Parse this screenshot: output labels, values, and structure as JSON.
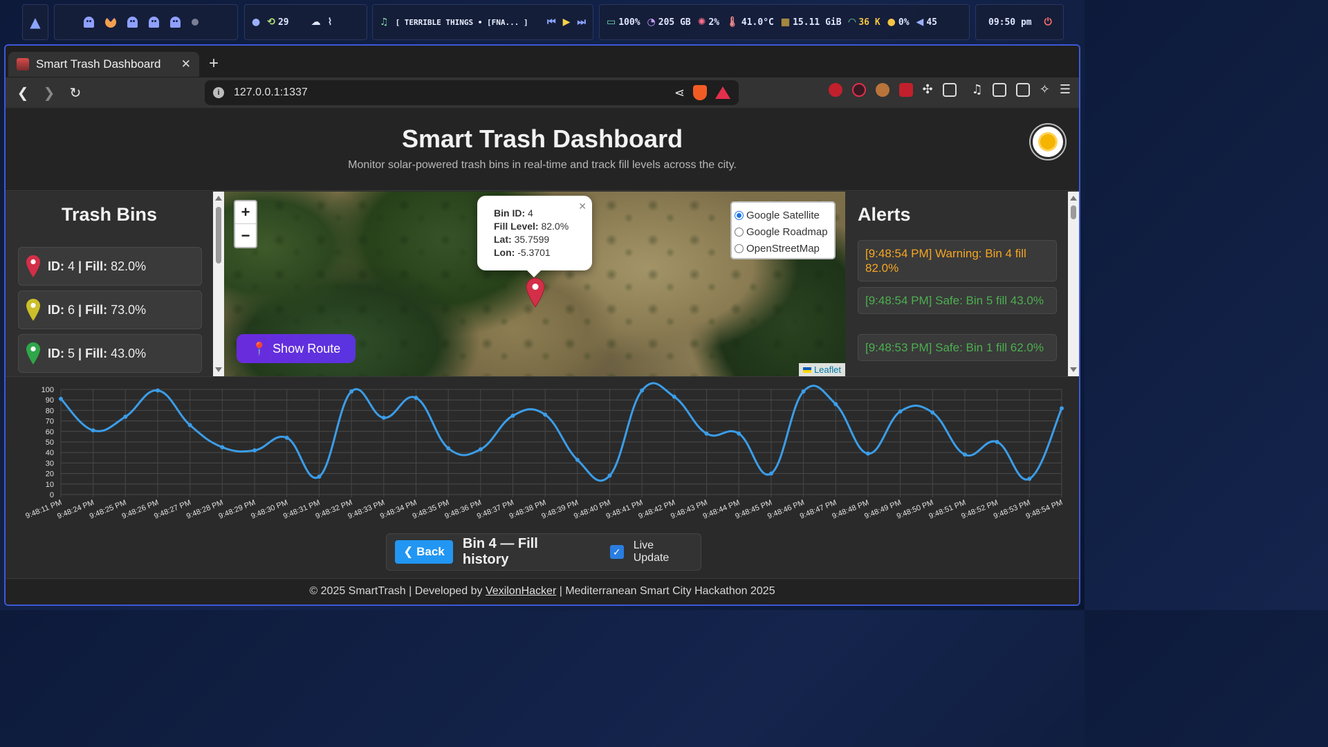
{
  "system_bar": {
    "git_count": "29",
    "music": "[ TERRIBLE THINGS • [FNA... ]",
    "battery": "100%",
    "disk": "205 GB",
    "cpu": "2%",
    "temp": "41.0°C",
    "ram": "15.11 GiB",
    "wifi": "36 K",
    "bright": "0%",
    "volume": "45",
    "clock": "09:50 pm"
  },
  "browser": {
    "tab_title": "Smart Trash Dashboard",
    "url": "127.0.0.1:1337"
  },
  "header": {
    "title": "Smart Trash Dashboard",
    "subtitle": "Monitor solar-powered trash bins in real-time and track fill levels across the city."
  },
  "bins": {
    "title": "Trash Bins",
    "id_label": "ID:",
    "fill_label": "| Fill:",
    "items": [
      {
        "id": "4",
        "fill": "82.0%",
        "color": "#d32f48"
      },
      {
        "id": "6",
        "fill": "73.0%",
        "color": "#cbbf2a"
      },
      {
        "id": "5",
        "fill": "43.0%",
        "color": "#2fa64a"
      }
    ]
  },
  "map": {
    "popup": {
      "bin_label": "Bin ID:",
      "bin_value": "4",
      "fill_label": "Fill Level:",
      "fill_value": "82.0%",
      "lat_label": "Lat:",
      "lat_value": "35.7599",
      "lon_label": "Lon:",
      "lon_value": "-5.3701"
    },
    "layers": [
      "Google Satellite",
      "Google Roadmap",
      "OpenStreetMap"
    ],
    "selected_layer": "Google Satellite",
    "route_button": "Show Route",
    "attribution": "Leaflet",
    "zoom_in": "+",
    "zoom_out": "−"
  },
  "alerts": {
    "title": "Alerts",
    "items": [
      {
        "text": "[9:48:54 PM] Warning: Bin 4 fill 82.0%",
        "level": "warn"
      },
      {
        "text": "[9:48:54 PM] Safe: Bin 5 fill 43.0%",
        "level": "safe"
      },
      {
        "text": "[9:48:53 PM] Safe: Bin 1 fill 62.0%",
        "level": "safe"
      }
    ]
  },
  "history": {
    "back_label": "❮ Back",
    "title": "Bin 4 — Fill history",
    "live_label": "Live Update",
    "live_checked": true
  },
  "chart_data": {
    "type": "line",
    "ylim": [
      0,
      100
    ],
    "yticks": [
      0,
      10,
      20,
      30,
      40,
      50,
      60,
      70,
      80,
      90,
      100
    ],
    "grid": true,
    "line_color": "#3b9de8",
    "categories": [
      "9:48:11 PM",
      "9:48:24 PM",
      "9:48:25 PM",
      "9:48:26 PM",
      "9:48:27 PM",
      "9:48:28 PM",
      "9:48:29 PM",
      "9:48:30 PM",
      "9:48:31 PM",
      "9:48:32 PM",
      "9:48:33 PM",
      "9:48:34 PM",
      "9:48:35 PM",
      "9:48:36 PM",
      "9:48:37 PM",
      "9:48:38 PM",
      "9:48:39 PM",
      "9:48:40 PM",
      "9:48:41 PM",
      "9:48:42 PM",
      "9:48:43 PM",
      "9:48:44 PM",
      "9:48:45 PM",
      "9:48:46 PM",
      "9:48:47 PM",
      "9:48:48 PM",
      "9:48:49 PM",
      "9:48:50 PM",
      "9:48:51 PM",
      "9:48:52 PM",
      "9:48:53 PM",
      "9:48:54 PM"
    ],
    "values": [
      91,
      61,
      74,
      99,
      66,
      45,
      42,
      54,
      17,
      98,
      73,
      92,
      44,
      43,
      75,
      76,
      33,
      18,
      99,
      93,
      58,
      58,
      20,
      98,
      86,
      39,
      79,
      78,
      38,
      50,
      15,
      82
    ]
  },
  "footer": {
    "pre": "© 2025 SmartTrash | Developed by ",
    "link": "VexilonHacker",
    "post": " | Mediterranean Smart City Hackathon 2025"
  }
}
